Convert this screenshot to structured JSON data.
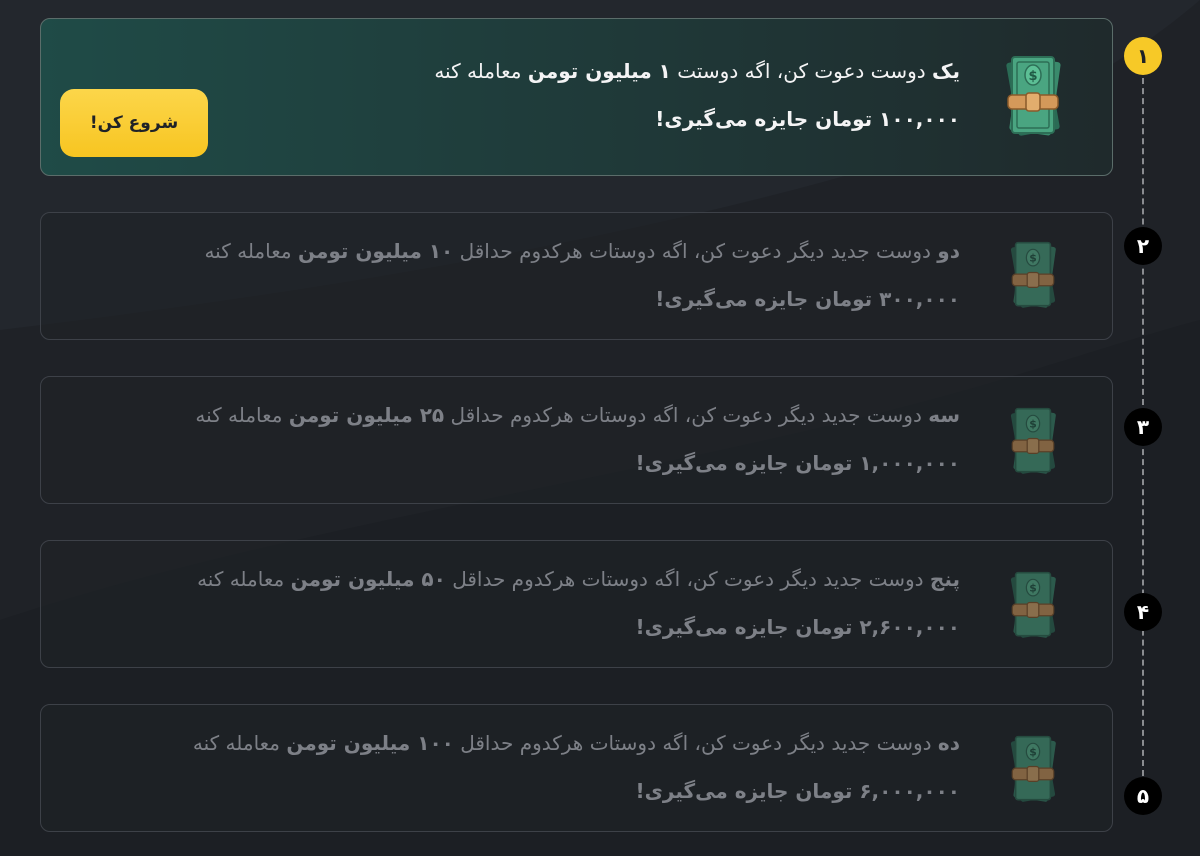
{
  "action_button": {
    "label": "شروع کن!"
  },
  "steps": [
    {
      "number": "۱",
      "status": "active",
      "line1": {
        "count": "یک",
        "prefix": " دوست دعوت کن، اگه دوستت ",
        "amount": "۱ میلیون تومن",
        "suffix": " معامله کنه"
      },
      "line2": "۱۰۰,۰۰۰ تومان جایزه می‌گیری!"
    },
    {
      "number": "۲",
      "status": "locked",
      "line1": {
        "count": "دو",
        "prefix": " دوست جدید دیگر دعوت کن، اگه دوستات هرکدوم حداقل ",
        "amount": "۱۰ میلیون تومن",
        "suffix": " معامله کنه"
      },
      "line2": "۳۰۰,۰۰۰ تومان جایزه می‌گیری!"
    },
    {
      "number": "۳",
      "status": "locked",
      "line1": {
        "count": "سه",
        "prefix": " دوست جدید دیگر دعوت کن، اگه دوستات هرکدوم حداقل ",
        "amount": "۲۵ میلیون تومن",
        "suffix": " معامله کنه"
      },
      "line2": "۱,۰۰۰,۰۰۰ تومان جایزه می‌گیری!"
    },
    {
      "number": "۴",
      "status": "locked",
      "line1": {
        "count": "پنج",
        "prefix": " دوست جدید دیگر دعوت کن، اگه دوستات هرکدوم حداقل ",
        "amount": "۵۰ میلیون تومن",
        "suffix": " معامله کنه"
      },
      "line2": "۲,۶۰۰,۰۰۰ تومان جایزه می‌گیری!"
    },
    {
      "number": "۵",
      "status": "locked",
      "line1": {
        "count": "ده",
        "prefix": " دوست جدید دیگر دعوت کن، اگه دوستات هرکدوم حداقل ",
        "amount": "۱۰۰ میلیون تومن",
        "suffix": " معامله کنه"
      },
      "line2": "۶,۰۰۰,۰۰۰ تومان جایزه می‌گیری!"
    }
  ],
  "colors": {
    "accent": "#f7c927",
    "active_card": "#1f4b47",
    "background": "#1f2227"
  },
  "icons": {
    "reward": "money-stack-icon"
  }
}
